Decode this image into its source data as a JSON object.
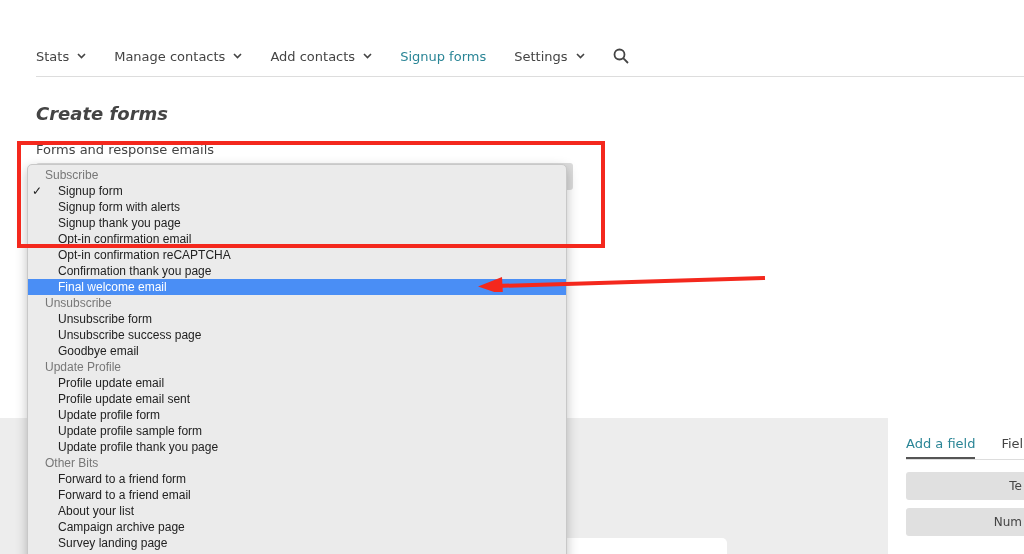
{
  "nav": {
    "items": [
      {
        "label": "Stats",
        "caret": true,
        "selected": false
      },
      {
        "label": "Manage contacts",
        "caret": true,
        "selected": false
      },
      {
        "label": "Add contacts",
        "caret": true,
        "selected": false
      },
      {
        "label": "Signup forms",
        "caret": false,
        "selected": true
      },
      {
        "label": "Settings",
        "caret": true,
        "selected": false
      }
    ]
  },
  "page_title": "Create forms",
  "form_label": "Forms and response emails",
  "dropdown": {
    "items": [
      {
        "kind": "header",
        "label": "Subscribe"
      },
      {
        "kind": "option",
        "label": "Signup form",
        "checked": true,
        "selected": false
      },
      {
        "kind": "option",
        "label": "Signup form with alerts",
        "checked": false,
        "selected": false
      },
      {
        "kind": "option",
        "label": "Signup thank you page",
        "checked": false,
        "selected": false
      },
      {
        "kind": "option",
        "label": "Opt-in confirmation email",
        "checked": false,
        "selected": false
      },
      {
        "kind": "option",
        "label": "Opt-in confirmation reCAPTCHA",
        "checked": false,
        "selected": false
      },
      {
        "kind": "option",
        "label": "Confirmation thank you page",
        "checked": false,
        "selected": false
      },
      {
        "kind": "option",
        "label": "Final welcome email",
        "checked": false,
        "selected": true
      },
      {
        "kind": "header",
        "label": "Unsubscribe"
      },
      {
        "kind": "option",
        "label": "Unsubscribe form",
        "checked": false,
        "selected": false
      },
      {
        "kind": "option",
        "label": "Unsubscribe success page",
        "checked": false,
        "selected": false
      },
      {
        "kind": "option",
        "label": "Goodbye email",
        "checked": false,
        "selected": false
      },
      {
        "kind": "header",
        "label": "Update Profile"
      },
      {
        "kind": "option",
        "label": "Profile update email",
        "checked": false,
        "selected": false
      },
      {
        "kind": "option",
        "label": "Profile update email sent",
        "checked": false,
        "selected": false
      },
      {
        "kind": "option",
        "label": "Update profile form",
        "checked": false,
        "selected": false
      },
      {
        "kind": "option",
        "label": "Update profile sample form",
        "checked": false,
        "selected": false
      },
      {
        "kind": "option",
        "label": "Update profile thank you page",
        "checked": false,
        "selected": false
      },
      {
        "kind": "header",
        "label": "Other Bits"
      },
      {
        "kind": "option",
        "label": "Forward to a friend form",
        "checked": false,
        "selected": false
      },
      {
        "kind": "option",
        "label": "Forward to a friend email",
        "checked": false,
        "selected": false
      },
      {
        "kind": "option",
        "label": "About your list",
        "checked": false,
        "selected": false
      },
      {
        "kind": "option",
        "label": "Campaign archive page",
        "checked": false,
        "selected": false
      },
      {
        "kind": "option",
        "label": "Survey landing page",
        "checked": false,
        "selected": false
      }
    ]
  },
  "check_mark": "✓",
  "side_panel": {
    "tabs": [
      {
        "label": "Add a field",
        "selected": true
      },
      {
        "label": "Fiel",
        "selected": false
      }
    ],
    "buttons": [
      "Te",
      "Num"
    ]
  }
}
